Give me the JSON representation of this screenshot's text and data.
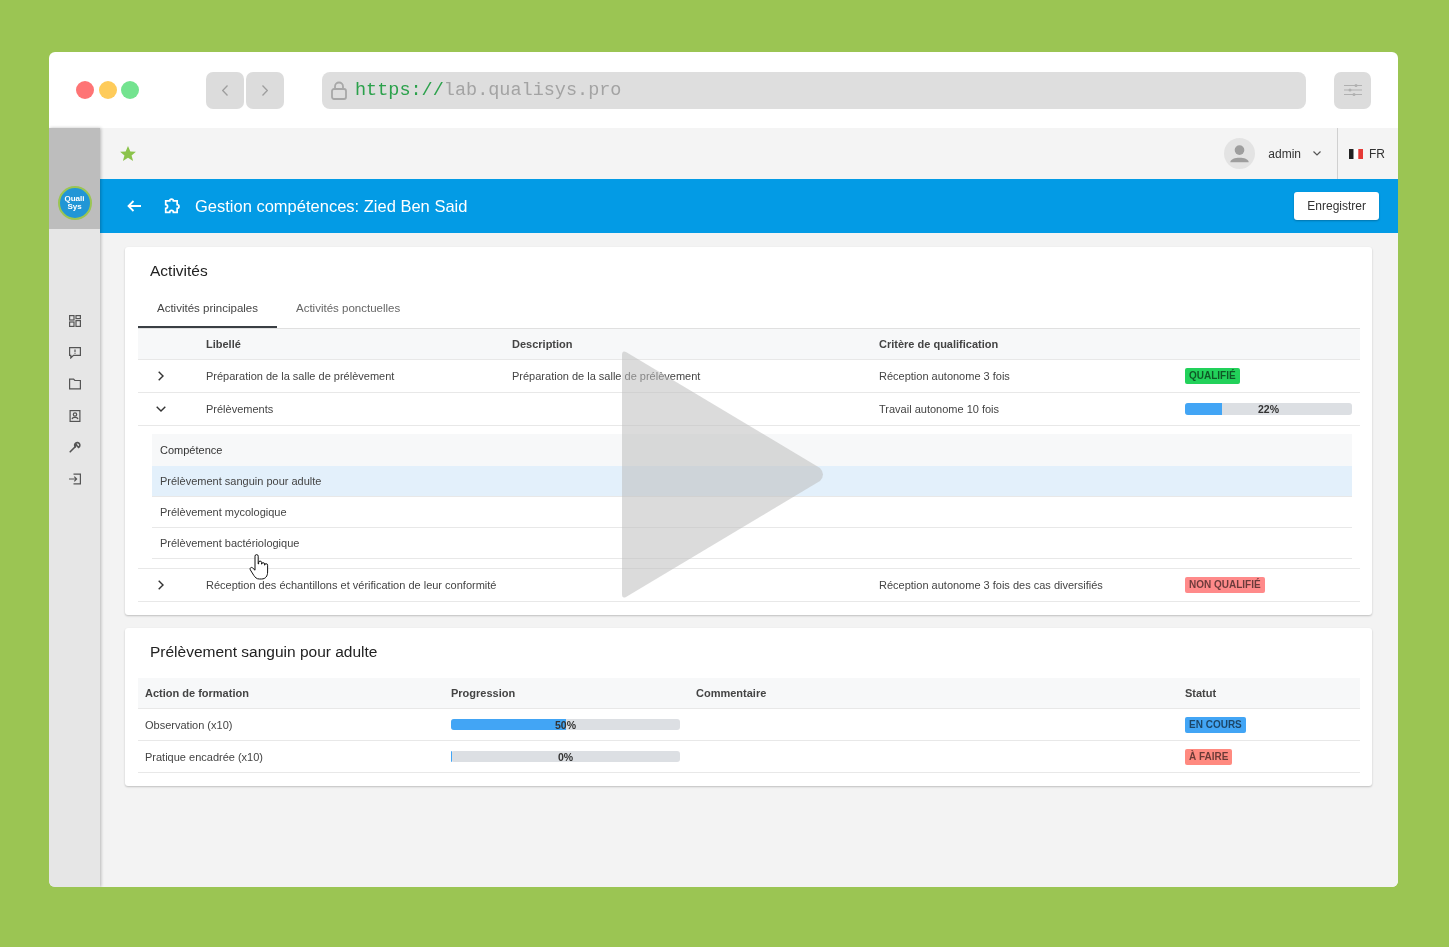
{
  "browser": {
    "url_scheme": "https://",
    "url_host": "lab.qualisys.pro"
  },
  "sidebar": {
    "logo_text": [
      "Quali",
      "Sys"
    ]
  },
  "top_bar": {
    "user": "admin",
    "language": "FR"
  },
  "page_header": {
    "title": "Gestion compétences: Zied Ben Said",
    "save_button": "Enregistrer"
  },
  "activities": {
    "title": "Activités",
    "tabs": [
      {
        "label": "Activités principales",
        "selected": true
      },
      {
        "label": "Activités ponctuelles",
        "selected": false
      }
    ],
    "columns": [
      "Libellé",
      "Description",
      "Critère de qualification"
    ],
    "rows": [
      {
        "label": "Préparation de la salle de prélèvement",
        "description": "Préparation de la salle de prélèvement",
        "criterion": "Réception autonome 3 fois",
        "expanded": false,
        "kind": "badge",
        "status": "QUALIFIÉ",
        "color": "#22d15a"
      },
      {
        "label": "Prélèvements",
        "criterion": "Travail autonome 10 fois",
        "expanded": true,
        "kind": "progress",
        "level": 0.22,
        "reading": "22%",
        "competences": {
          "header": "Compétence",
          "items": [
            {
              "label": "Prélèvement sanguin pour adulte",
              "selected": true
            },
            {
              "label": "Prélèvement mycologique",
              "selected": false
            },
            {
              "label": "Prélèvement bactériologique",
              "selected": false
            }
          ]
        }
      },
      {
        "label": "Réception des échantillons et vérification de leur conformité",
        "criterion": "Réception autonome 3 fois des cas diversifiés",
        "expanded": false,
        "kind": "badge",
        "status": "NON QUALIFIÉ",
        "color": "#ff8a8a"
      }
    ]
  },
  "training": {
    "title": "Prélèvement sanguin pour adulte",
    "columns": [
      "Action de formation",
      "Progression",
      "Commentaire",
      "Statut"
    ],
    "rows": [
      {
        "action": "Observation (x10)",
        "level": 0.5,
        "reading": "50%",
        "status": "EN COURS",
        "color": "#42a5f5"
      },
      {
        "action": "Pratique encadrée (x10)",
        "level": 0,
        "reading": "0%",
        "status": "À FAIRE",
        "color": "#ff8a80"
      }
    ]
  }
}
